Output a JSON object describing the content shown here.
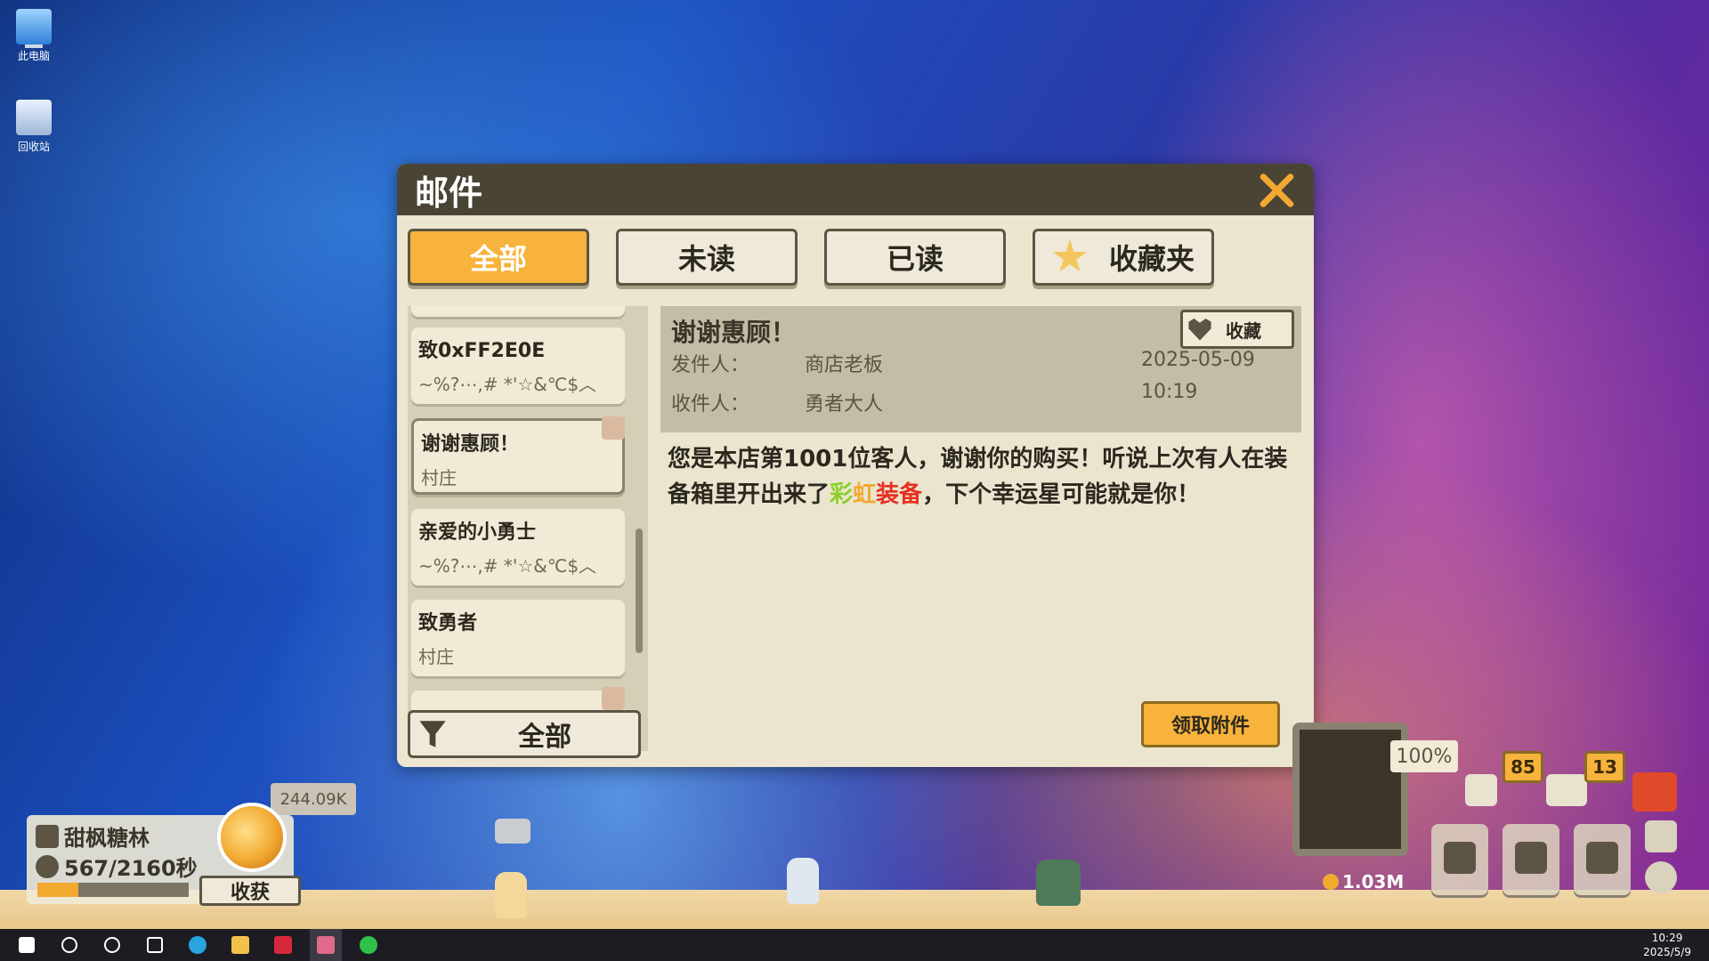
{
  "desktop": {
    "icons": [
      {
        "label": "此电脑",
        "icon": "computer-icon"
      },
      {
        "label": "回收站",
        "icon": "recycle-bin-icon"
      }
    ]
  },
  "mail": {
    "title": "邮件",
    "tabs": [
      {
        "label": "全部",
        "active": true
      },
      {
        "label": "未读"
      },
      {
        "label": "已读"
      },
      {
        "label": "收藏夹",
        "icon": "star-icon"
      }
    ],
    "list": [
      {
        "title": "致0xFF2E0E",
        "sender": "~%?⋯,# *'☆&℃$︿"
      },
      {
        "title": "谢谢惠顾！",
        "sender": "村庄",
        "selected": true
      },
      {
        "title": "亲爱的小勇士",
        "sender": "~%?⋯,# *'☆&℃$︿"
      },
      {
        "title": "致勇者",
        "sender": "村庄"
      }
    ],
    "filter_label": "全部",
    "reader": {
      "subject": "谢谢惠顾！",
      "favorite_label": "收藏",
      "sender_label": "发件人：",
      "sender": "商店老板",
      "recipient_label": "收件人：",
      "recipient": "勇者大人",
      "date": "2025-05-09",
      "time": "10:19",
      "body_1": "您是本店第1001位客人，谢谢你的购买！听说上次有人在装备箱里开出来了",
      "body_rainbow": [
        "彩",
        "虹",
        "装备"
      ],
      "body_2": "，下个幸运星可能就是你！",
      "claim_label": "领取附件"
    }
  },
  "hud": {
    "area_name": "甜枫糖林",
    "timer": "567/2160秒",
    "progress": 0.27,
    "coin_amount": "244.09K",
    "harvest_label": "收获",
    "percent": "100%",
    "badge_quests": "85",
    "badge_mail": "13",
    "gold": "1.03M"
  },
  "taskbar": {
    "time": "10:29",
    "date": "2025/5/9"
  },
  "colors": {
    "accent": "#f7b33c",
    "panel": "#ece5cf",
    "titlebar": "#4a4435"
  }
}
